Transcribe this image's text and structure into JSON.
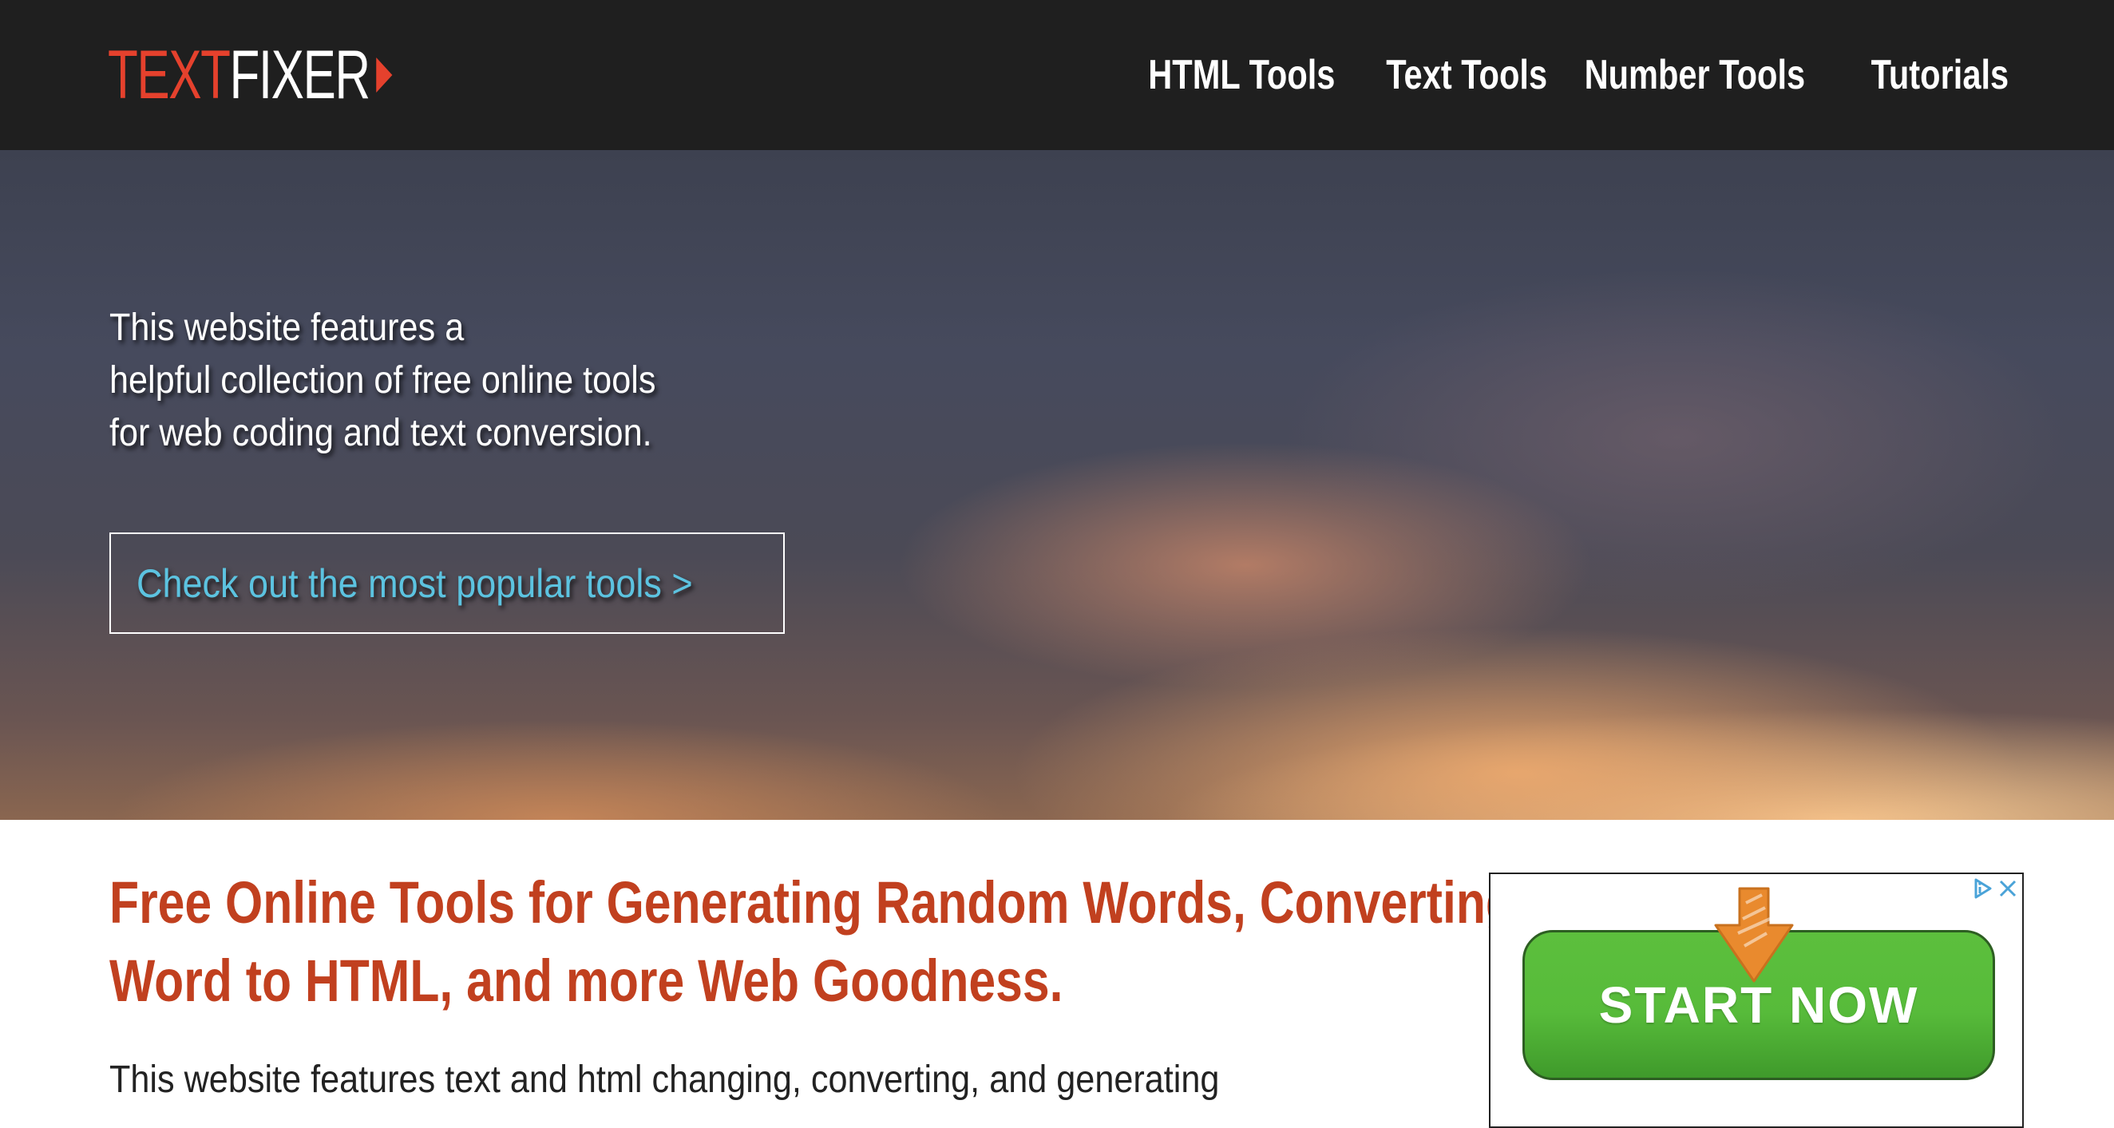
{
  "header": {
    "logo": {
      "part1": "TEXT",
      "part2": "FIXER",
      "icon": "play-triangle-icon"
    },
    "nav": [
      {
        "label": "HTML Tools"
      },
      {
        "label": "Text Tools"
      },
      {
        "label": "Number Tools"
      },
      {
        "label": "Tutorials"
      }
    ]
  },
  "hero": {
    "lines": [
      "This website features a",
      "helpful collection of free online tools",
      "for web coding and text conversion."
    ],
    "cta_label": "Check out the most popular tools >"
  },
  "main": {
    "heading_lines": [
      "Free Online Tools for Generating Random Words, Converting",
      "Word to HTML, and more Web Goodness."
    ],
    "intro": "This website features text and html changing, converting, and generating"
  },
  "ad": {
    "button_label": "START NOW",
    "icons": [
      "adchoices-icon",
      "close-icon"
    ]
  },
  "colors": {
    "nav_bg": "#1f1f1f",
    "brand_red": "#e5412d",
    "heading_red": "#c1401f",
    "cta_cyan": "#5cc3e0",
    "ad_green": "#57bb3a",
    "ad_icon_blue": "#4aa3d8"
  }
}
